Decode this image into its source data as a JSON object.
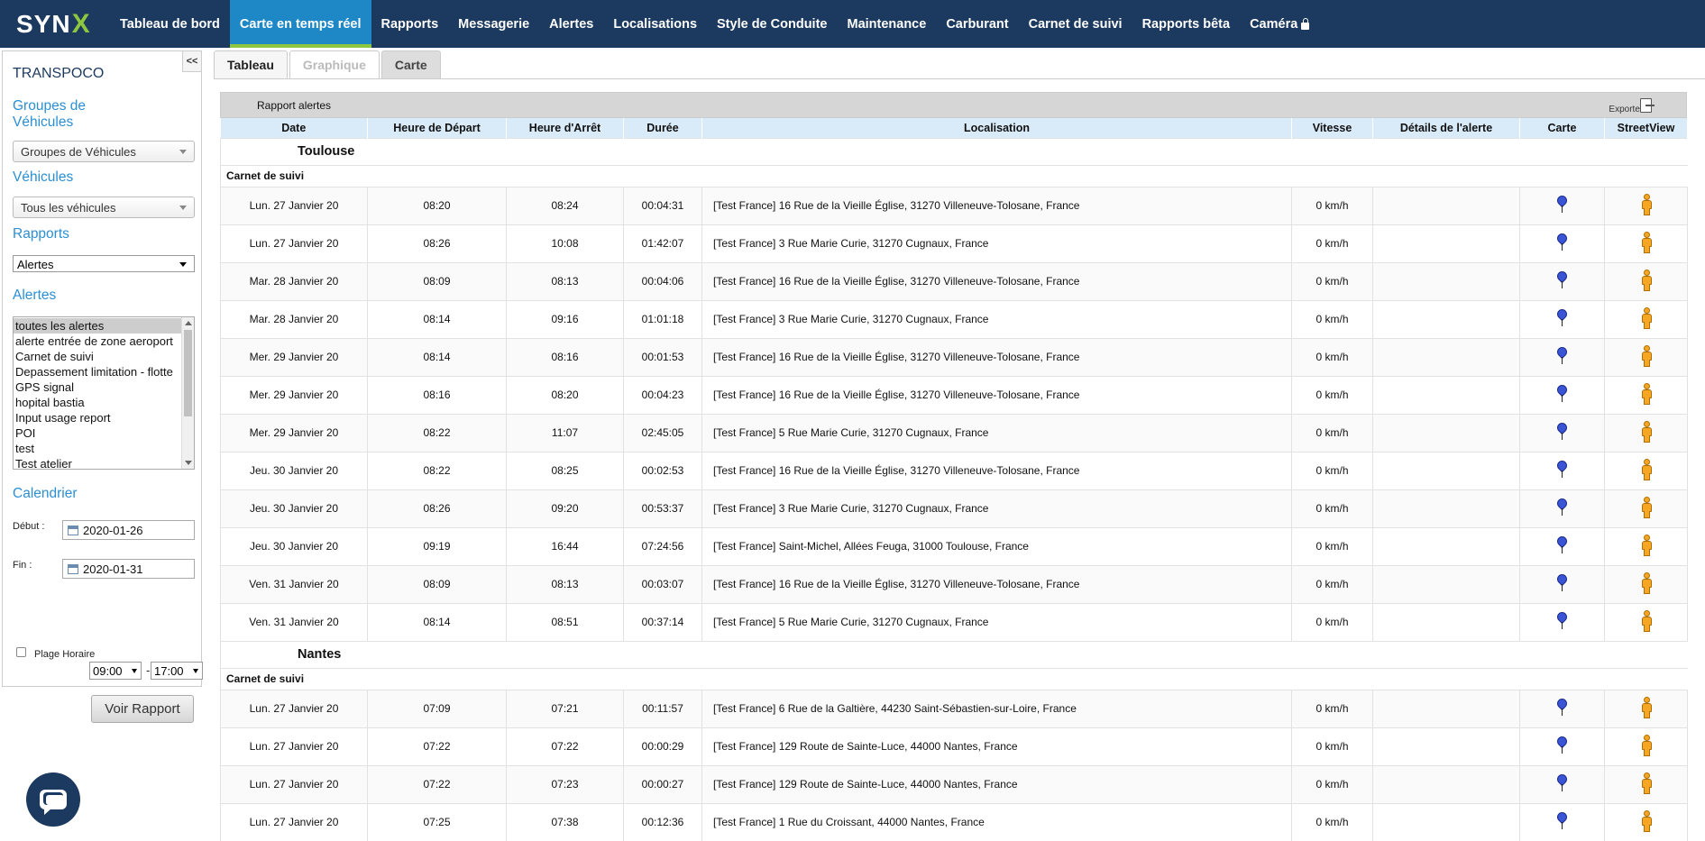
{
  "app": {
    "logo_text": "SYN",
    "logo_x": "X"
  },
  "nav": [
    {
      "label": "Tableau de bord",
      "active": false
    },
    {
      "label": "Carte en temps réel",
      "active": true
    },
    {
      "label": "Rapports",
      "active": false
    },
    {
      "label": "Messagerie",
      "active": false
    },
    {
      "label": "Alertes",
      "active": false
    },
    {
      "label": "Localisations",
      "active": false
    },
    {
      "label": "Style de Conduite",
      "active": false
    },
    {
      "label": "Maintenance",
      "active": false
    },
    {
      "label": "Carburant",
      "active": false
    },
    {
      "label": "Carnet de suivi",
      "active": false
    },
    {
      "label": "Rapports bêta",
      "active": false
    },
    {
      "label": "Caméra",
      "active": false,
      "locked": true
    }
  ],
  "sidebar": {
    "collapse_label": "<<",
    "company": "TRANSPOCO",
    "groups_title": "Groupes de Véhicules",
    "groups_select": "Groupes de Véhicules",
    "vehicles_title": "Véhicules",
    "vehicles_select": "Tous les véhicules",
    "reports_title": "Rapports",
    "reports_select": "Alertes",
    "alerts_title": "Alertes",
    "alerts_list": [
      "toutes les alertes",
      "alerte entrée de zone aeroport",
      "Carnet de suivi",
      "Depassement limitation - flotte",
      "GPS signal",
      "hopital bastia",
      "Input usage report",
      "POI",
      "test",
      "Test atelier"
    ],
    "alerts_selected_index": 0,
    "calendar_title": "Calendrier",
    "start_label": "Début :",
    "start_value": "2020-01-26",
    "end_label": "Fin :",
    "end_value": "2020-01-31",
    "time_range_label": "Plage Horaire",
    "time_start": "09:00",
    "time_sep": "-",
    "time_end": "17:00",
    "submit_label": "Voir Rapport"
  },
  "tabs": [
    {
      "label": "Tableau",
      "state": "active"
    },
    {
      "label": "Graphique",
      "state": "disabled"
    },
    {
      "label": "Carte",
      "state": "gray"
    }
  ],
  "report": {
    "title": "Rapport alertes",
    "export_label": "Exporter:",
    "columns": [
      "Date",
      "Heure de Départ",
      "Heure d'Arrêt",
      "Durée",
      "Localisation",
      "Vitesse",
      "Détails de l'alerte",
      "Carte",
      "StreetView"
    ],
    "groups": [
      {
        "city": "Toulouse",
        "category": "Carnet de suivi",
        "rows": [
          [
            "Lun. 27 Janvier 20",
            "08:20",
            "08:24",
            "00:04:31",
            "[Test France] 16 Rue de la Vieille Église, 31270 Villeneuve-Tolosane, France",
            "0 km/h",
            ""
          ],
          [
            "Lun. 27 Janvier 20",
            "08:26",
            "10:08",
            "01:42:07",
            "[Test France] 3 Rue Marie Curie, 31270 Cugnaux, France",
            "0 km/h",
            ""
          ],
          [
            "Mar. 28 Janvier 20",
            "08:09",
            "08:13",
            "00:04:06",
            "[Test France] 16 Rue de la Vieille Église, 31270 Villeneuve-Tolosane, France",
            "0 km/h",
            ""
          ],
          [
            "Mar. 28 Janvier 20",
            "08:14",
            "09:16",
            "01:01:18",
            "[Test France] 3 Rue Marie Curie, 31270 Cugnaux, France",
            "0 km/h",
            ""
          ],
          [
            "Mer. 29 Janvier 20",
            "08:14",
            "08:16",
            "00:01:53",
            "[Test France] 16 Rue de la Vieille Église, 31270 Villeneuve-Tolosane, France",
            "0 km/h",
            ""
          ],
          [
            "Mer. 29 Janvier 20",
            "08:16",
            "08:20",
            "00:04:23",
            "[Test France] 16 Rue de la Vieille Église, 31270 Villeneuve-Tolosane, France",
            "0 km/h",
            ""
          ],
          [
            "Mer. 29 Janvier 20",
            "08:22",
            "11:07",
            "02:45:05",
            "[Test France] 5 Rue Marie Curie, 31270 Cugnaux, France",
            "0 km/h",
            ""
          ],
          [
            "Jeu. 30 Janvier 20",
            "08:22",
            "08:25",
            "00:02:53",
            "[Test France] 16 Rue de la Vieille Église, 31270 Villeneuve-Tolosane, France",
            "0 km/h",
            ""
          ],
          [
            "Jeu. 30 Janvier 20",
            "08:26",
            "09:20",
            "00:53:37",
            "[Test France] 3 Rue Marie Curie, 31270 Cugnaux, France",
            "0 km/h",
            ""
          ],
          [
            "Jeu. 30 Janvier 20",
            "09:19",
            "16:44",
            "07:24:56",
            "[Test France] Saint-Michel, Allées Feuga, 31000 Toulouse, France",
            "0 km/h",
            ""
          ],
          [
            "Ven. 31 Janvier 20",
            "08:09",
            "08:13",
            "00:03:07",
            "[Test France] 16 Rue de la Vieille Église, 31270 Villeneuve-Tolosane, France",
            "0 km/h",
            ""
          ],
          [
            "Ven. 31 Janvier 20",
            "08:14",
            "08:51",
            "00:37:14",
            "[Test France] 5 Rue Marie Curie, 31270 Cugnaux, France",
            "0 km/h",
            ""
          ]
        ]
      },
      {
        "city": "Nantes",
        "category": "Carnet de suivi",
        "rows": [
          [
            "Lun. 27 Janvier 20",
            "07:09",
            "07:21",
            "00:11:57",
            "[Test France] 6 Rue de la Galtière, 44230 Saint-Sébastien-sur-Loire, France",
            "0 km/h",
            ""
          ],
          [
            "Lun. 27 Janvier 20",
            "07:22",
            "07:22",
            "00:00:29",
            "[Test France] 129 Route de Sainte-Luce, 44000 Nantes, France",
            "0 km/h",
            ""
          ],
          [
            "Lun. 27 Janvier 20",
            "07:22",
            "07:23",
            "00:00:27",
            "[Test France] 129 Route de Sainte-Luce, 44000 Nantes, France",
            "0 km/h",
            ""
          ],
          [
            "Lun. 27 Janvier 20",
            "07:25",
            "07:38",
            "00:12:36",
            "[Test France] 1 Rue du Croissant, 44000 Nantes, France",
            "0 km/h",
            ""
          ]
        ]
      }
    ]
  },
  "colors": {
    "nav_bg": "#1c3a5f",
    "nav_active": "#1e88c7",
    "accent_green": "#8dc63f",
    "section_blue": "#2b8fd2"
  }
}
